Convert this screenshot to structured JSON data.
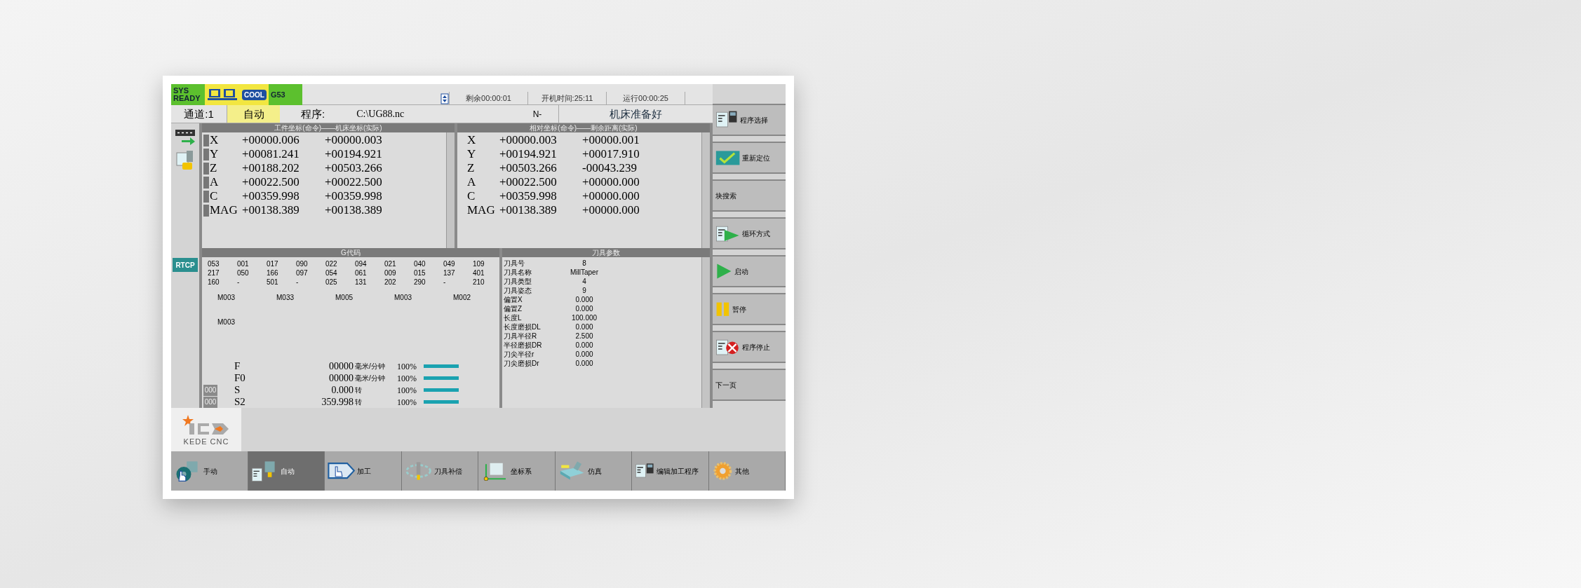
{
  "status_badges": [
    {
      "kind": "text",
      "label": "SYS READY",
      "color": "#5cc02e"
    },
    {
      "kind": "computers",
      "color": "#f2e640"
    },
    {
      "kind": "coolant",
      "label": "COOL",
      "color": "#f2e640"
    },
    {
      "kind": "text",
      "label": "G53",
      "color": "#5cc02e"
    }
  ],
  "info_fields": [
    "剩余00:00:01",
    "开机时间:25:11",
    "运行00:00:25"
  ],
  "channel": "通道:1",
  "mode": "自动",
  "program_label": "程序:",
  "program_path": "C:\\UG88.nc",
  "block": "N-",
  "machine_status": "机床准备好",
  "coord_panels": [
    {
      "title": "工件坐标(命令)——机床坐标(实际)",
      "markers": true,
      "rows": [
        {
          "axis": "X",
          "values": [
            "+00000.006",
            "+00000.003"
          ]
        },
        {
          "axis": "Y",
          "values": [
            "+00081.241",
            "+00194.921"
          ]
        },
        {
          "axis": "Z",
          "values": [
            "+00188.202",
            "+00503.266"
          ]
        },
        {
          "axis": "A",
          "values": [
            "+00022.500",
            "+00022.500"
          ]
        },
        {
          "axis": "C",
          "values": [
            "+00359.998",
            "+00359.998"
          ]
        },
        {
          "axis": "MAG",
          "values": [
            "+00138.389",
            "+00138.389"
          ]
        }
      ]
    },
    {
      "title": "相对坐标(命令)——剩余距离(实际)",
      "markers": false,
      "rows": [
        {
          "axis": "X",
          "values": [
            "+00000.003",
            "+00000.001"
          ]
        },
        {
          "axis": "Y",
          "values": [
            "+00194.921",
            "+00017.910"
          ]
        },
        {
          "axis": "Z",
          "values": [
            "+00503.266",
            "-00043.239"
          ]
        },
        {
          "axis": "A",
          "values": [
            "+00022.500",
            "+00000.000"
          ]
        },
        {
          "axis": "C",
          "values": [
            "+00359.998",
            "+00000.000"
          ]
        },
        {
          "axis": "MAG",
          "values": [
            "+00138.389",
            "+00000.000"
          ]
        }
      ]
    }
  ],
  "side_icons": [
    {
      "kind": "xyz"
    },
    {
      "kind": "tool"
    },
    {
      "kind": "rtcp",
      "label": "RTCP"
    }
  ],
  "gcode_panel": {
    "title": "G代码",
    "rows": [
      [
        "053",
        "001",
        "017",
        "090",
        "022",
        "094",
        "021",
        "040",
        "049",
        "109"
      ],
      [
        "217",
        "050",
        "166",
        "097",
        "054",
        "061",
        "009",
        "015",
        "137",
        "401"
      ],
      [
        "160",
        "-",
        "501",
        "-",
        "025",
        "131",
        "202",
        "290",
        "-",
        "210"
      ]
    ],
    "m_codes": [
      "M003",
      "M033",
      "M005",
      "M003",
      "M002"
    ],
    "m_codes_2": [
      "M003"
    ]
  },
  "feeds": [
    {
      "name": "F",
      "value": "00000",
      "unit": "毫米/分钟",
      "override": "100%",
      "level": 1
    },
    {
      "name": "F0",
      "value": "00000",
      "unit": "毫米/分钟",
      "override": "100%",
      "level": 1
    },
    {
      "name": "S",
      "marker": "000",
      "value": "0.000",
      "unit": "转",
      "override": "100%",
      "level": 1
    },
    {
      "name": "S2",
      "marker": "000",
      "value": "359.998",
      "unit": "转",
      "override": "100%",
      "level": 1
    }
  ],
  "tool_panel": {
    "title": "刀具参数",
    "rows": [
      {
        "label": "刀具号",
        "value": "8"
      },
      {
        "label": "刀具名称",
        "value": "MillTaper"
      },
      {
        "label": "刀具类型",
        "value": "4"
      },
      {
        "label": "刀具姿态",
        "value": "9"
      },
      {
        "label": "偏置X",
        "value": "0.000"
      },
      {
        "label": "偏置Z",
        "value": "0.000"
      },
      {
        "label": "长度L",
        "value": "100.000"
      },
      {
        "label": "长度磨损DL",
        "value": "0.000"
      },
      {
        "label": "刀具半径R",
        "value": "2.500"
      },
      {
        "label": "半径磨损DR",
        "value": "0.000"
      },
      {
        "label": "刀尖半径r",
        "value": "0.000"
      },
      {
        "label": "刀尖磨损Dr",
        "value": "0.000"
      }
    ]
  },
  "right_softkeys": [
    {
      "kind": "program",
      "label": "程序选择"
    },
    {
      "kind": "check",
      "label": "重新定位"
    },
    {
      "kind": "none",
      "label": "块搜索"
    },
    {
      "kind": "program_play",
      "label": "循环方式"
    },
    {
      "kind": "play",
      "label": "启动"
    },
    {
      "kind": "pause",
      "label": "暂停"
    },
    {
      "kind": "program_stop",
      "label": "程序停止"
    },
    {
      "kind": "none",
      "label": "下一页"
    }
  ],
  "logo": {
    "text": "KEDE CNC"
  },
  "bottom_softkeys": [
    {
      "kind": "handwheel",
      "label": "手动",
      "selected": false
    },
    {
      "kind": "program_tool",
      "label": "自动",
      "selected": true
    },
    {
      "kind": "hand",
      "label": "加工",
      "selected": false
    },
    {
      "kind": "tool_ring",
      "label": "刀具补偿",
      "selected": false
    },
    {
      "kind": "axes",
      "label": "坐标系",
      "selected": false
    },
    {
      "kind": "sim",
      "label": "仿真",
      "selected": false
    },
    {
      "kind": "program",
      "label": "编辑加工程序",
      "selected": false
    },
    {
      "kind": "gear",
      "label": "其他",
      "selected": false
    }
  ]
}
